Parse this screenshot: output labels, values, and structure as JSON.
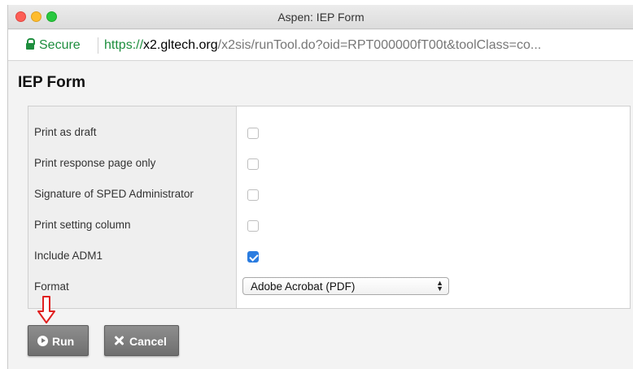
{
  "window": {
    "title": "Aspen: IEP Form"
  },
  "address_bar": {
    "secure_label": "Secure",
    "url_scheme": "https://",
    "url_host": "x2.gltech.org",
    "url_path": "/x2sis/runTool.do?oid=RPT000000fT00t&toolClass=co..."
  },
  "form": {
    "title": "IEP Form",
    "fields": [
      {
        "label": "Print as draft",
        "checked": false
      },
      {
        "label": "Print response page only",
        "checked": false
      },
      {
        "label": "Signature of SPED Administrator",
        "checked": false
      },
      {
        "label": "Print setting column",
        "checked": false
      },
      {
        "label": "Include ADM1",
        "checked": true
      }
    ],
    "format": {
      "label": "Format",
      "selected": "Adobe Acrobat (PDF)"
    }
  },
  "buttons": {
    "run_label": "Run",
    "cancel_label": "Cancel"
  },
  "colors": {
    "secure_green": "#1e8e3e",
    "checkbox_checked": "#2a7ce0",
    "arrow_indicator": "#e02020",
    "button_gray": "#777777"
  },
  "icons": {
    "lock": "lock-icon",
    "run": "play-circle-icon",
    "cancel": "close-icon",
    "indicator": "down-arrow-icon"
  }
}
